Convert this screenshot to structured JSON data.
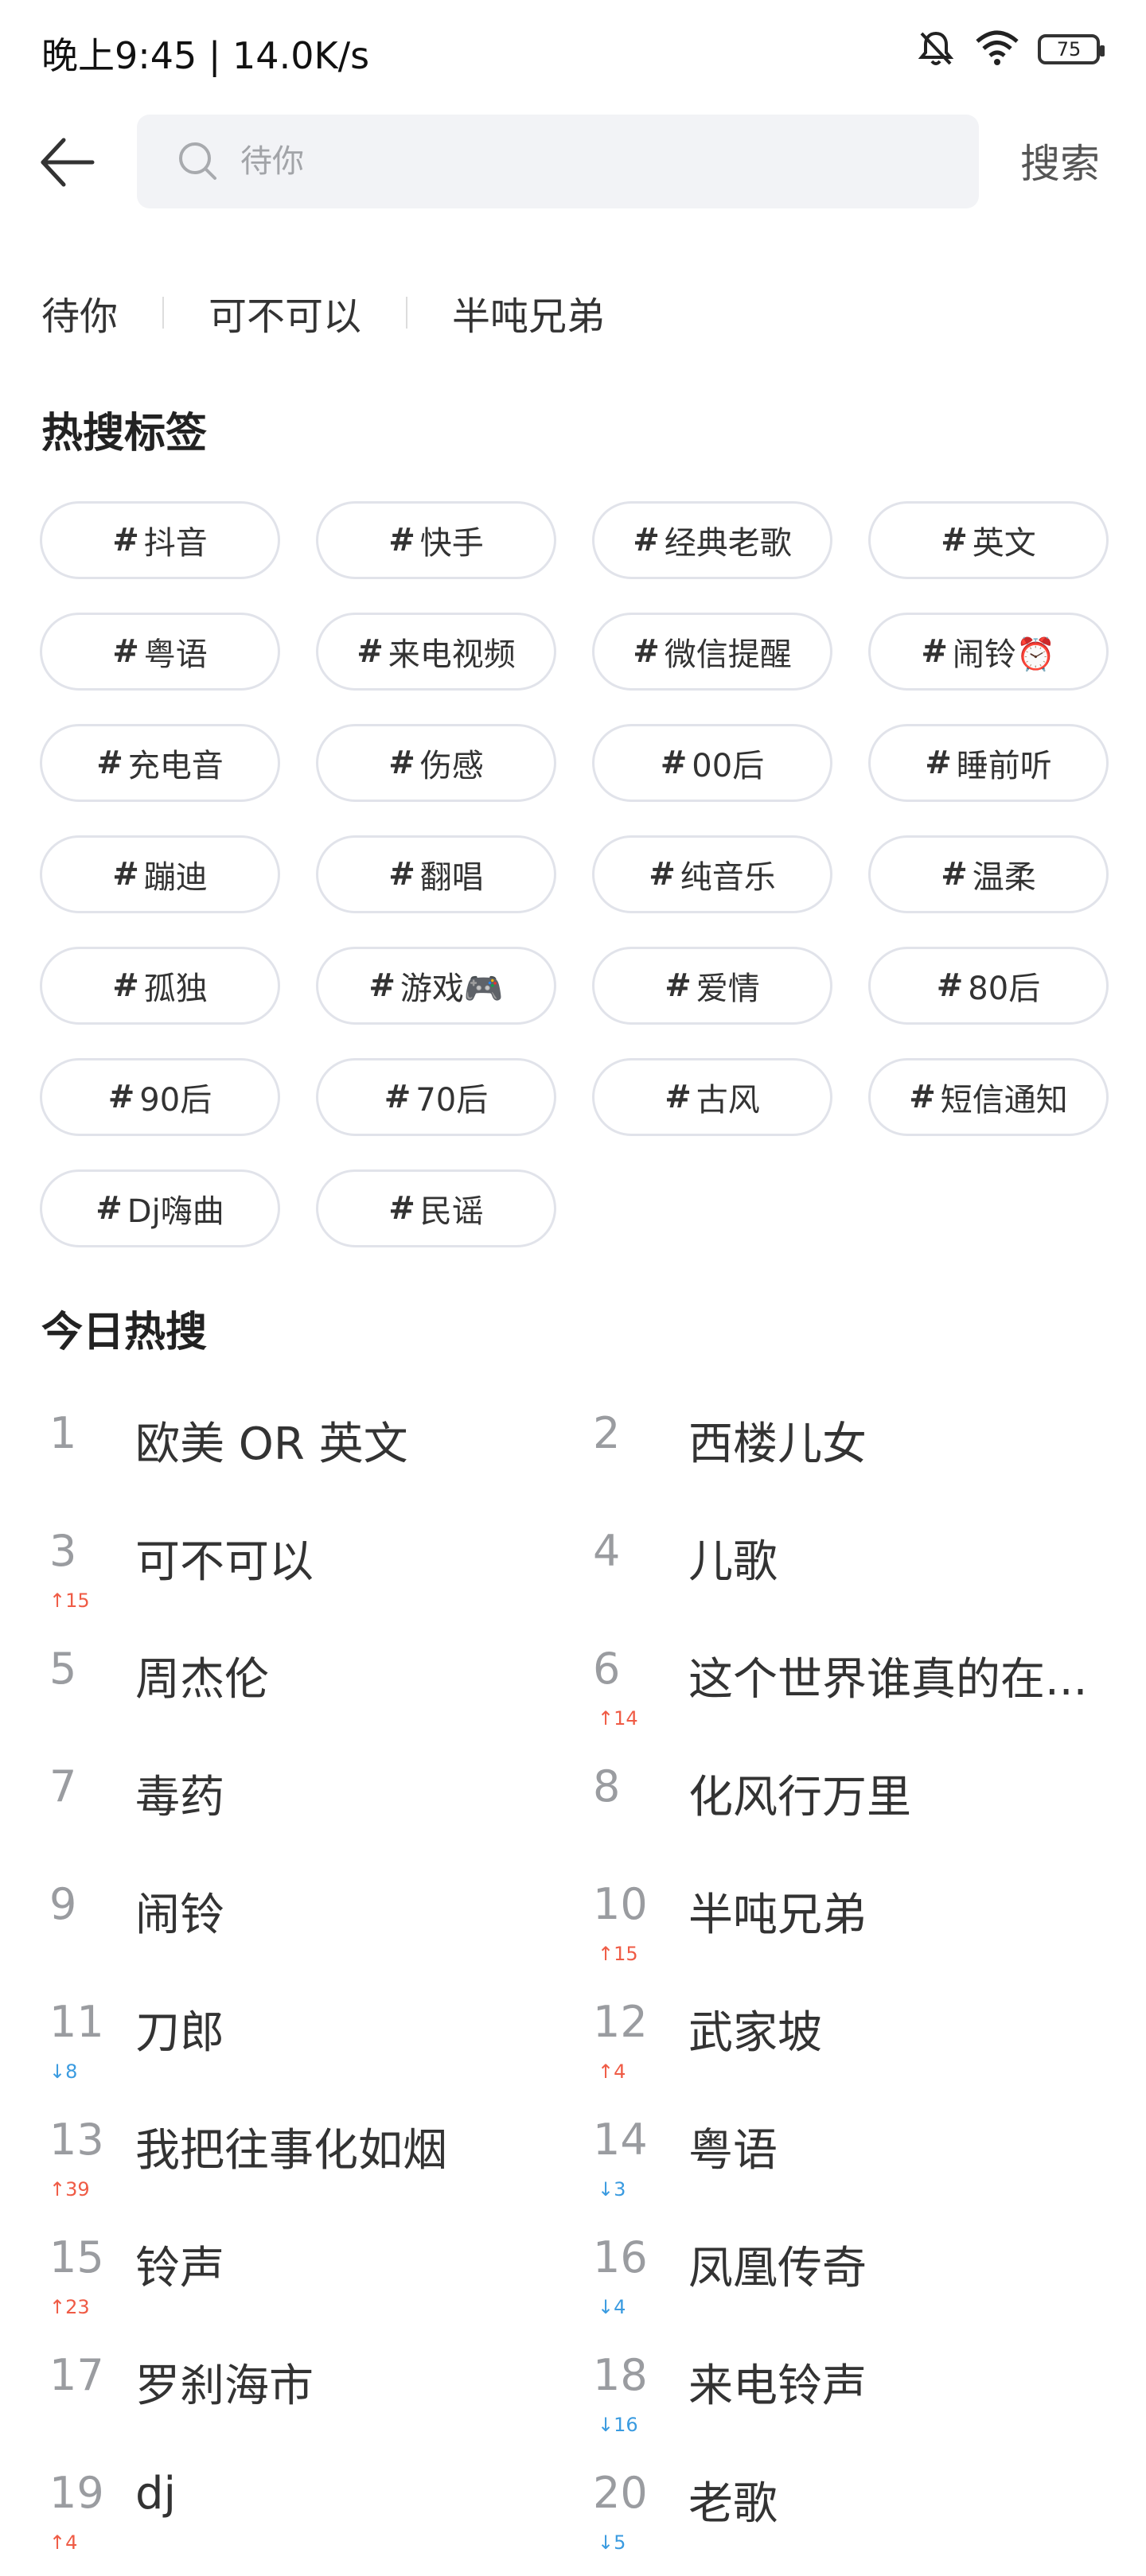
{
  "status": {
    "time": "晚上9:45 | 14.0K/s",
    "battery": "75"
  },
  "search": {
    "placeholder": "待你",
    "button": "搜索"
  },
  "history": [
    "待你",
    "可不可以",
    "半吨兄弟"
  ],
  "tags_title": "热搜标签",
  "tags": [
    "抖音",
    "快手",
    "经典老歌",
    "英文",
    "粤语",
    "来电视频",
    "微信提醒",
    "闹铃⏰",
    "充电音",
    "伤感",
    "00后",
    "睡前听",
    "蹦迪",
    "翻唱",
    "纯音乐",
    "温柔",
    "孤独",
    "游戏🎮",
    "爱情",
    "80后",
    "90后",
    "70后",
    "古风",
    "短信通知",
    "Dj嗨曲",
    "民谣"
  ],
  "hot_title": "今日热搜",
  "hot_list": [
    {
      "rank": "1",
      "title": "欧美 OR 英文",
      "change": "",
      "dir": ""
    },
    {
      "rank": "2",
      "title": "西楼儿女",
      "change": "",
      "dir": ""
    },
    {
      "rank": "3",
      "title": "可不可以",
      "change": "↑15",
      "dir": "up"
    },
    {
      "rank": "4",
      "title": "儿歌",
      "change": "",
      "dir": ""
    },
    {
      "rank": "5",
      "title": "周杰伦",
      "change": "",
      "dir": ""
    },
    {
      "rank": "6",
      "title": "这个世界谁真的在...",
      "change": "↑14",
      "dir": "up"
    },
    {
      "rank": "7",
      "title": "毒药",
      "change": "",
      "dir": ""
    },
    {
      "rank": "8",
      "title": "化风行万里",
      "change": "",
      "dir": ""
    },
    {
      "rank": "9",
      "title": "闹铃",
      "change": "",
      "dir": ""
    },
    {
      "rank": "10",
      "title": "半吨兄弟",
      "change": "↑15",
      "dir": "up"
    },
    {
      "rank": "11",
      "title": "刀郎",
      "change": "↓8",
      "dir": "down"
    },
    {
      "rank": "12",
      "title": "武家坡",
      "change": "↑4",
      "dir": "up"
    },
    {
      "rank": "13",
      "title": "我把往事化如烟",
      "change": "↑39",
      "dir": "up"
    },
    {
      "rank": "14",
      "title": "粤语",
      "change": "↓3",
      "dir": "down"
    },
    {
      "rank": "15",
      "title": "铃声",
      "change": "↑23",
      "dir": "up"
    },
    {
      "rank": "16",
      "title": "凤凰传奇",
      "change": "↓4",
      "dir": "down"
    },
    {
      "rank": "17",
      "title": "罗刹海市",
      "change": "",
      "dir": ""
    },
    {
      "rank": "18",
      "title": "来电铃声",
      "change": "↓16",
      "dir": "down"
    },
    {
      "rank": "19",
      "title": "dj",
      "change": "↑4",
      "dir": "up"
    },
    {
      "rank": "20",
      "title": "老歌",
      "change": "↓5",
      "dir": "down"
    }
  ],
  "colors": {
    "up": "#ef5b45",
    "down": "#3a9be0",
    "search_bg": "#f2f3f6",
    "tag_border": "#e1e3ea"
  },
  "icons": [
    "back-arrow-icon",
    "search-icon",
    "bell-mute-icon",
    "wifi-icon",
    "battery-icon"
  ]
}
